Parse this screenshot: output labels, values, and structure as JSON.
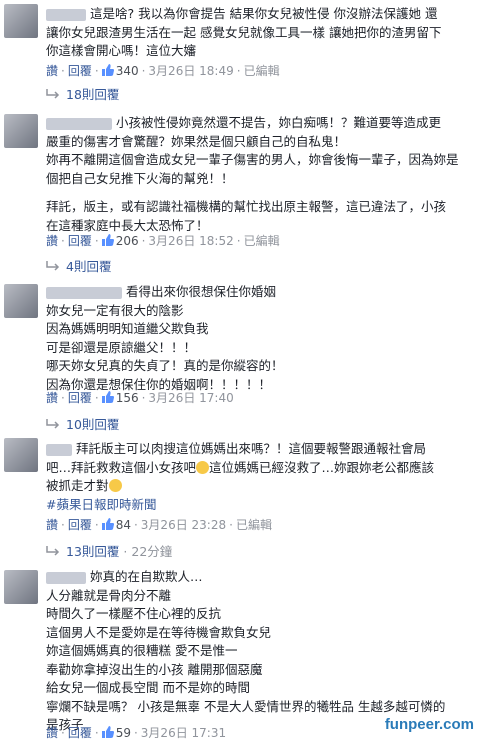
{
  "actions": {
    "reply": "回覆",
    "edited": "已編輯",
    "date": "3月26日"
  },
  "comments": [
    {
      "lines": [
        "這是啥? 我以為你會提告 結果你女兒被性侵 你沒辦法保護她 還",
        "讓你女兒跟渣男生活在一起 感覺女兒就像工具一樣 讓她把你的渣男留下",
        "你這樣會開心嗎！這位大嬸"
      ],
      "likes": "340",
      "time": "18:49",
      "edited": true,
      "replies": "18則回覆",
      "reply_time": ""
    },
    {
      "lines": [
        "小孩被性侵妳竟然還不提告，妳白痴嗎！？難道要等造成更",
        "嚴重的傷害才會驚醒？妳果然是個只顧自己的自私鬼！",
        "妳再不離開這個會造成女兒一輩子傷害的男人，妳會後悔一輩子，因為妳是",
        "個把自己女兒推下火海的幫兇！！",
        "",
        "拜託，版主，或有認識社福機構的幫忙找出原主報警，這已違法了，小孩",
        "在這種家庭中長大太恐怖了！"
      ],
      "likes": "206",
      "time": "18:52",
      "edited": true,
      "replies": "4則回覆",
      "reply_time": ""
    },
    {
      "lines": [
        "看得出來你很想保住你婚姻",
        "妳女兒一定有很大的陰影",
        "因為媽媽明明知道繼父欺負我",
        "可是卻還是原諒繼父！！！",
        "哪天妳女兒真的失貞了！真的是你縱容的！",
        "因為你還是想保住你的婚姻啊！！！！！"
      ],
      "likes": "156",
      "time": "17:40",
      "edited": false,
      "replies": "10則回覆",
      "reply_time": ""
    },
    {
      "lines": [
        "拜託版主可以肉搜這位媽媽出來嗎？！這個要報警跟通報社會局",
        "吧…拜託救救這個小女孩吧",
        "這位媽媽已經沒救了…妳跟妳老公都應該",
        "被抓走才對"
      ],
      "hashtag": "#蘋果日報即時新聞",
      "likes": "84",
      "time": "23:28",
      "edited": true,
      "replies": "13則回覆",
      "reply_time": "22分鐘"
    },
    {
      "lines": [
        "妳真的在自欺欺人…",
        "人分離就是骨肉分不離",
        "時間久了一樣壓不住心裡的反抗",
        "這個男人不是愛妳是在等待機會欺負女兒",
        "妳這個媽媽真的很糟糕 愛不是惟一",
        "奉勸妳拿掉沒出生的小孩 離開那個惡魔",
        "給女兒一個成長空間 而不是妳的時間",
        "寧爛不缺是嗎？ 小孩是無辜 不是大人愛情世界的犧牲品 生越多越可憐的",
        "是孩子"
      ],
      "likes": "59",
      "time": "17:31",
      "edited": false,
      "replies": "",
      "reply_time": ""
    }
  ],
  "watermark": "funpeer.com"
}
